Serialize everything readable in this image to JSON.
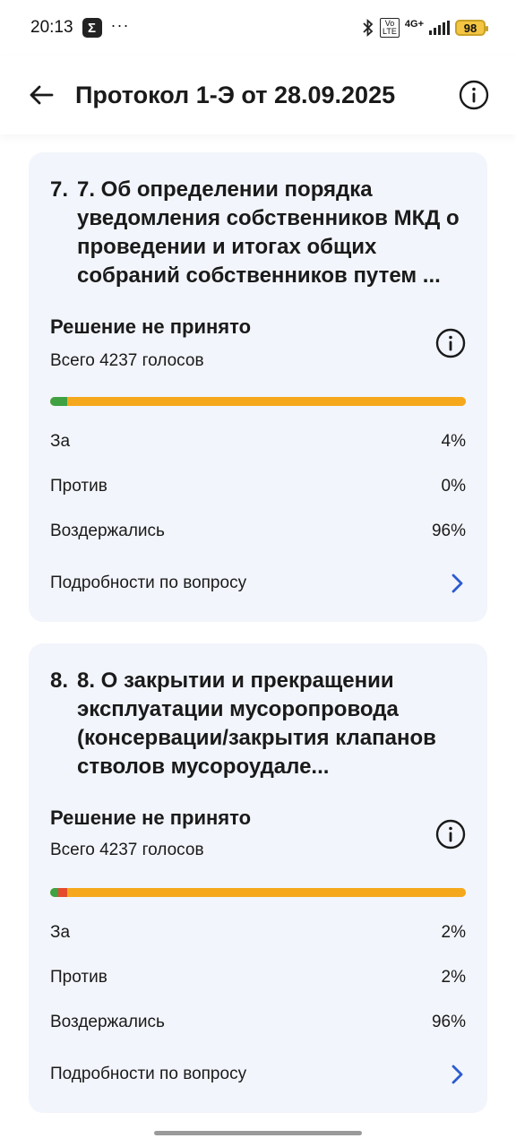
{
  "status_bar": {
    "time": "20:13",
    "sigma": "Σ",
    "dots": "···",
    "network_badge_top": "Vo",
    "network_badge_bottom": "LTE",
    "network_type": "4G+",
    "battery": "98"
  },
  "header": {
    "title": "Протокол 1-Э от 28.09.2025"
  },
  "colors": {
    "for": "#3fa142",
    "against": "#e64a2e",
    "abstain": "#f6a81c",
    "link_chevron": "#2c5bd0",
    "card_bg": "#f2f5fb"
  },
  "questions": [
    {
      "number": "7.",
      "title": "7. Об определении порядка уведомления собственников МКД о проведении и итогах общих собраний собственников путем ...",
      "decision": "Решение не принято",
      "total": "Всего 4237 голосов",
      "bar": {
        "for": 0.04,
        "against": 0.0,
        "abstain": 0.96
      },
      "rows": [
        {
          "label": "За",
          "value": "4%"
        },
        {
          "label": "Против",
          "value": "0%"
        },
        {
          "label": "Воздержались",
          "value": "96%"
        }
      ],
      "details_label": "Подробности по вопросу"
    },
    {
      "number": "8.",
      "title": "8. О закрытии и прекращении эксплуатации мусоропровода (консервации/закрытия клапанов стволов мусороудале...",
      "decision": "Решение не принято",
      "total": "Всего 4237 голосов",
      "bar": {
        "for": 0.02,
        "against": 0.02,
        "abstain": 0.96
      },
      "rows": [
        {
          "label": "За",
          "value": "2%"
        },
        {
          "label": "Против",
          "value": "2%"
        },
        {
          "label": "Воздержались",
          "value": "96%"
        }
      ],
      "details_label": "Подробности по вопросу"
    }
  ]
}
